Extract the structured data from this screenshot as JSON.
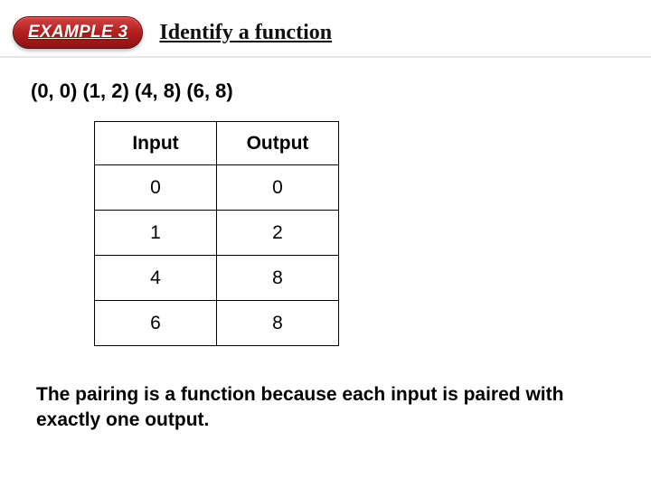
{
  "header": {
    "badge": "EXAMPLE 3",
    "title": "Identify a function"
  },
  "pairs_text": "(0, 0) (1, 2) (4, 8) (6, 8)",
  "table": {
    "headers": {
      "input": "Input",
      "output": "Output"
    },
    "rows": [
      {
        "input": "0",
        "output": "0"
      },
      {
        "input": "1",
        "output": "2"
      },
      {
        "input": "4",
        "output": "8"
      },
      {
        "input": "6",
        "output": "8"
      }
    ]
  },
  "conclusion": "The pairing is a function because each input is paired with exactly one output."
}
